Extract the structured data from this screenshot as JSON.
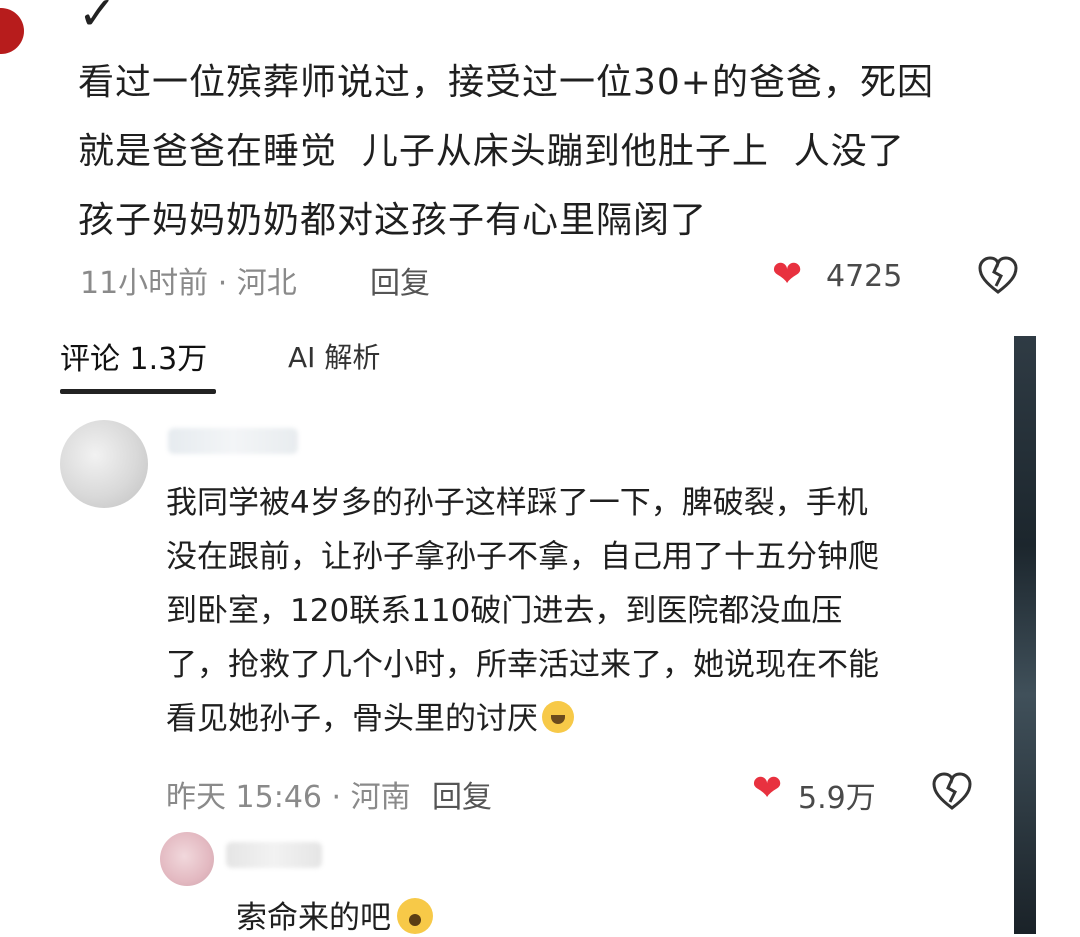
{
  "post": {
    "lines": [
      "看过一位殡葬师说过，接受过一位30+的爸爸，死因",
      "就是爸爸在睡觉  儿子从床头蹦到他肚子上  人没了",
      "孩子妈妈奶奶都对这孩子有心里隔阂了"
    ],
    "meta": "11小时前 · 河北",
    "reply_label": "回复",
    "like_count": "4725"
  },
  "tabs": {
    "comments": "评论 1.3万",
    "ai": "AI 解析"
  },
  "comment": {
    "lines": [
      "我同学被4岁多的孙子这样踩了一下，脾破裂，手机",
      "没在跟前，让孙子拿孙子不拿，自己用了十五分钟爬",
      "到卧室，120联系110破门进去，到医院都没血压",
      "了，抢救了几个小时，所幸活过来了，她说现在不能",
      "看见她孙子，骨头里的讨厌"
    ],
    "meta": "昨天 15:46 · 河南",
    "reply_label": "回复",
    "like_count": "5.9万"
  },
  "subreply": {
    "text": "索命来的吧"
  },
  "colors": {
    "like": "#e8313f",
    "meta": "#8a8a8a"
  },
  "icons": [
    "heart-icon",
    "broken-heart-icon",
    "check-icon",
    "crying-emoji-icon",
    "shocked-emoji-icon"
  ]
}
